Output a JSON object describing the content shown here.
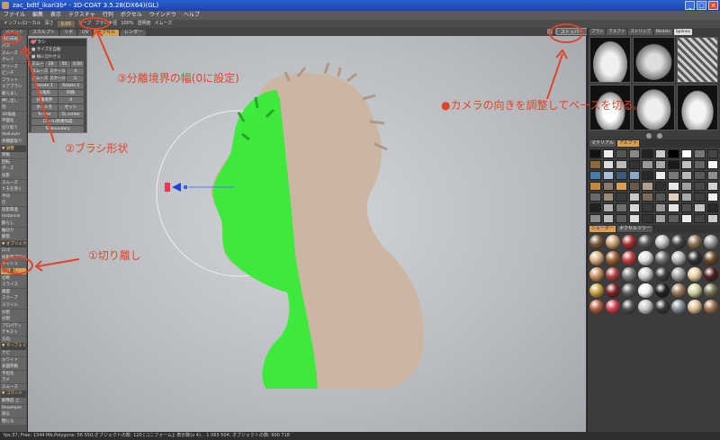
{
  "window": {
    "title": "zac_bdtf_ikari3b* - 3D-COAT 3.5.28(DX64)(GL)"
  },
  "menu": [
    "ファイル",
    "編集",
    "表示",
    "テクスチャ",
    "行列",
    "ボクセル",
    "ウインドウ",
    "ヘルプ"
  ],
  "toolbar": {
    "items": [
      "インフレ/ローカル",
      "深さ",
      "カーブ",
      "ブラシ半径",
      "100%",
      "透明度",
      "イムーズ"
    ],
    "highlight": "0.00"
  },
  "tabs": {
    "items": [
      "ペイント",
      "スカルプト",
      "リポ",
      "UV",
      "ボクセル",
      "レンダー"
    ],
    "active": 4,
    "camera_button": "ストッパー"
  },
  "left_panel": {
    "items": [
      {
        "label": "磁石描画",
        "head": false
      },
      {
        "label": "パス",
        "head": false
      },
      {
        "label": "スムーズ",
        "head": false
      },
      {
        "label": "クレイ",
        "head": false
      },
      {
        "label": "クリーズ",
        "head": false
      },
      {
        "label": "ピンチ",
        "head": false
      },
      {
        "label": "フラット",
        "head": false
      },
      {
        "label": "エアブラシ",
        "head": false
      },
      {
        "label": "膨らまし",
        "head": false
      },
      {
        "label": "押し出し",
        "head": false
      },
      {
        "label": "泡",
        "head": false
      },
      {
        "label": "3D描画",
        "head": false
      },
      {
        "label": "平面化",
        "head": false
      },
      {
        "label": "切り取り",
        "head": false
      },
      {
        "label": "VoxLayer",
        "head": false
      },
      {
        "label": "体積面取り",
        "head": false
      },
      {
        "label": "▼ 調整",
        "head": true
      },
      {
        "label": "移動",
        "head": false
      },
      {
        "label": "回転",
        "head": false
      },
      {
        "label": "ポーズ",
        "head": false
      },
      {
        "label": "投影",
        "head": false
      },
      {
        "label": "スムーズ",
        "head": false
      },
      {
        "label": "ヒモを巻く",
        "head": false
      },
      {
        "label": "平均",
        "head": false
      },
      {
        "label": "刃",
        "head": false
      },
      {
        "label": "投影関連",
        "head": false
      },
      {
        "label": "Instancer",
        "head": false
      },
      {
        "label": "膨らし",
        "head": false
      },
      {
        "label": "輪切り",
        "head": false
      },
      {
        "label": "膨張",
        "head": false
      },
      {
        "label": "▼ オブジェクト",
        "head": true
      },
      {
        "label": "ロゴ",
        "head": false
      },
      {
        "label": "投影用プロジ",
        "head": false
      },
      {
        "label": "メッシュ",
        "head": false
      },
      {
        "label": "切り離し",
        "head": false,
        "selected": true
      },
      {
        "label": "切断",
        "head": false
      },
      {
        "label": "スライス",
        "head": false
      },
      {
        "label": "鏡面",
        "head": false
      },
      {
        "label": "スクープ",
        "head": false
      },
      {
        "label": "スマイル",
        "head": false
      },
      {
        "label": "分割",
        "head": false
      },
      {
        "label": "分割",
        "head": false
      },
      {
        "label": "プロパティ",
        "head": false
      },
      {
        "label": "テキスト",
        "head": false
      },
      {
        "label": "方向",
        "head": false
      },
      {
        "label": "▼ サーフェイス",
        "head": true
      },
      {
        "label": "ナビ",
        "head": false
      },
      {
        "label": "ホワイト",
        "head": false
      },
      {
        "label": "表面移動",
        "head": false
      },
      {
        "label": "平坦化",
        "head": false
      },
      {
        "label": "ラメ",
        "head": false
      },
      {
        "label": "スムーズ",
        "head": false
      },
      {
        "label": "▼ コマンド",
        "head": true
      },
      {
        "label": "解像度 上",
        "head": false
      },
      {
        "label": "Resample",
        "head": false
      },
      {
        "label": "測る",
        "head": false
      },
      {
        "label": "閉じる",
        "head": false
      }
    ]
  },
  "brush_panel": {
    "title": "ブラシ",
    "rows": [
      [
        "Rotate 1",
        "Rotate 2"
      ],
      [
        "三角形",
        "四角"
      ],
      [
        "分離境界",
        "0"
      ],
      [
        "ホールを",
        "セット"
      ],
      [
        "To line",
        "To center"
      ]
    ],
    "checks": [
      "サイズを自動",
      "輪に沿わせる"
    ],
    "mid_rows": [
      [
        "スムーズ",
        "20",
        "50",
        "0.00"
      ],
      [
        "スムーズ",
        "スケール",
        "4"
      ],
      [
        "スムーズ",
        "スケール",
        "2"
      ]
    ],
    "footer": [
      "ロール/新規作成",
      "To boundary"
    ]
  },
  "right_panel": {
    "stencil_tabs": [
      "ブラシ",
      "アルファ",
      "ストリップ",
      "Models",
      "Splines"
    ],
    "stencil_active": 4,
    "material_tabs": [
      "マテリアル",
      "アルファ"
    ],
    "material_active": 1,
    "shader_tabs": [
      "シェーダー",
      "ボクセルツリー"
    ],
    "shader_active": 0
  },
  "statusbar": {
    "text": "fps:37;  Free: 1344 Mb,Polygons: 56 550;オブジェクトの数: 120 [コニフォーム]; 表示数(x 4)... 1 063 504; オブジェクトの数: 900 718"
  },
  "annotations": {
    "a1": "①切り離し",
    "a2": "②ブラシ形状",
    "a3": "③分離境界の幅(0に設定)",
    "a4": "●カメラの向きを調整してベースを切る。"
  },
  "colors": {
    "annotation": "#e0452a",
    "selected": "#d8a050",
    "cut_highlight": "#33ee33",
    "clay": "#cbb6a4"
  }
}
